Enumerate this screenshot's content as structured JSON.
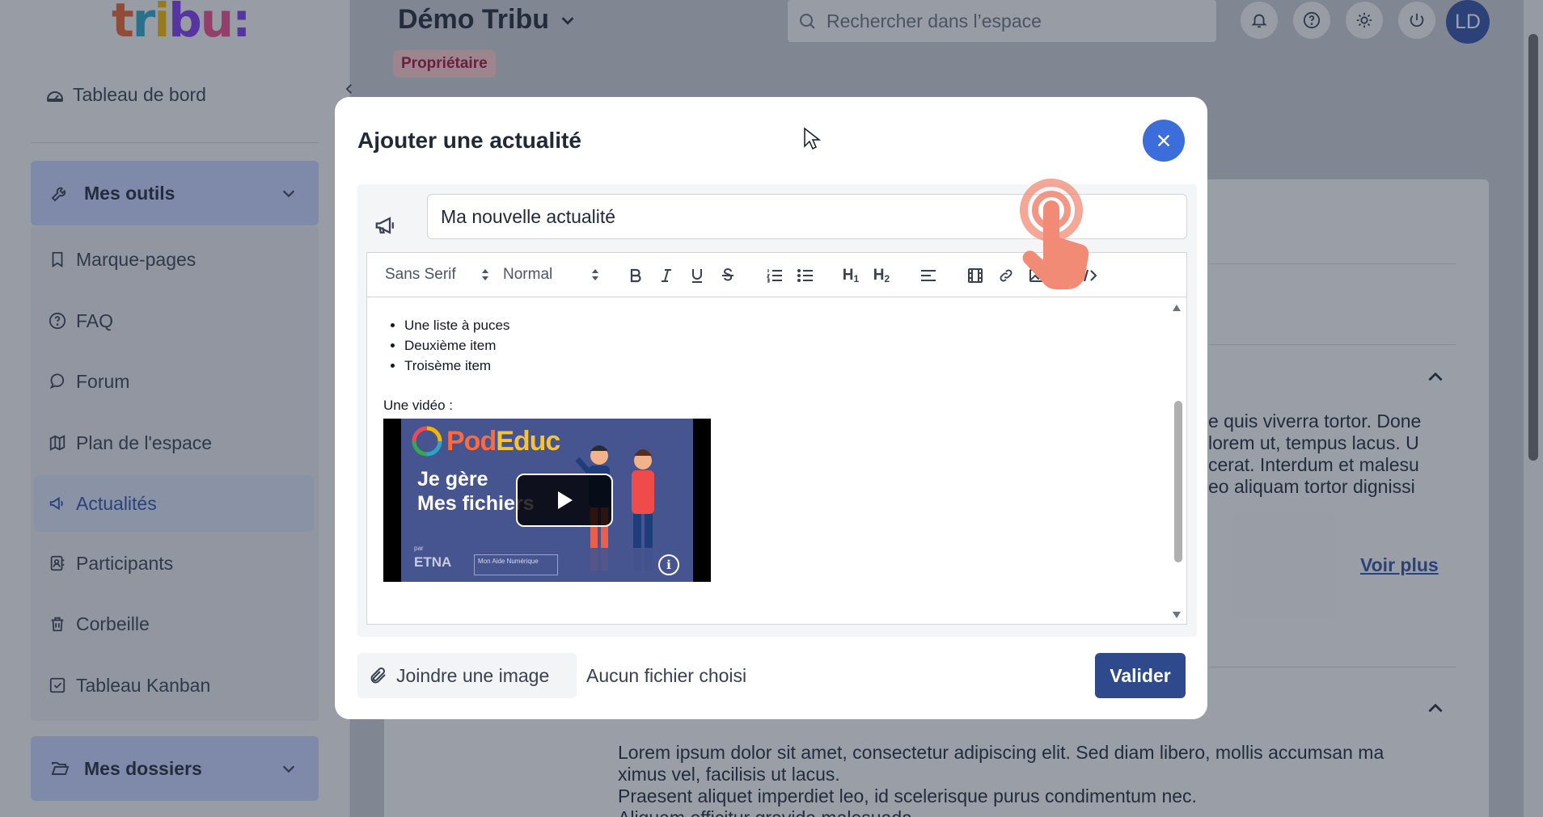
{
  "logo": {
    "text": "tribu:",
    "colors": [
      "#e8612c",
      "#2aa7c7",
      "#f4b400",
      "#7c3aed",
      "#e94b8a",
      "#7c3aed"
    ]
  },
  "sidebar": {
    "dashboard": "Tableau de bord",
    "tools_group": "Mes outils",
    "items": [
      {
        "label": "Marque-pages",
        "icon": "bookmark-icon"
      },
      {
        "label": "FAQ",
        "icon": "help-circle-icon"
      },
      {
        "label": "Forum",
        "icon": "chat-icon"
      },
      {
        "label": "Plan de l'espace",
        "icon": "map-icon"
      },
      {
        "label": "Actualités",
        "icon": "megaphone-icon",
        "active": true
      },
      {
        "label": "Participants",
        "icon": "contacts-icon"
      },
      {
        "label": "Corbeille",
        "icon": "trash-icon"
      },
      {
        "label": "Tableau Kanban",
        "icon": "check-square-icon"
      }
    ],
    "folders_group": "Mes dossiers"
  },
  "header": {
    "space_title": "Démo Tribu",
    "role": "Propriétaire",
    "search_placeholder": "Rechercher dans l’espace",
    "avatar_initials": "LD"
  },
  "background": {
    "para1": [
      "e quis viverra tortor. Done",
      "lorem ut, tempus lacus. U",
      "cerat. Interdum et malesu",
      "eo aliquam tortor dignissi"
    ],
    "voir_plus": "Voir plus",
    "para2": [
      "Lorem ipsum dolor sit amet, consectetur adipiscing elit. Sed diam libero, mollis accumsan ma",
      "ximus vel, facilisis ut lacus.",
      "Praesent aliquet imperdiet leo, id scelerisque purus condimentum nec.",
      "Aliquam efficitur gravida malesuada."
    ]
  },
  "modal": {
    "title": "Ajouter une actualité",
    "news_title_value": "Ma nouvelle actualité",
    "toolbar": {
      "font": "Sans Serif",
      "size": "Normal",
      "h1": "H",
      "h2": "H"
    },
    "content": {
      "bullets": [
        "Une liste à puces",
        "Deuxième item",
        "Troisème item"
      ],
      "video_label": "Une vidéo :",
      "video": {
        "brand": "PodEduc",
        "line1": "Je gère",
        "line2": "Mes fichiers",
        "footer_par": "par",
        "footer_logo": "ETNA",
        "footer_partner": "Mon Aide Numérique"
      }
    },
    "attach_label": "Joindre une image",
    "no_file": "Aucun fichier choisi",
    "submit": "Valider"
  }
}
